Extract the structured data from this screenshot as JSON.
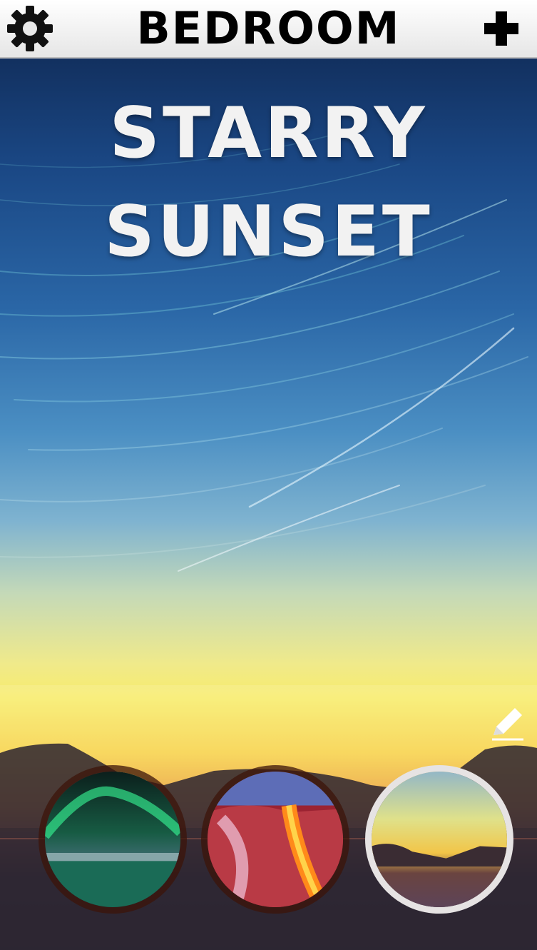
{
  "header": {
    "title": "BEDROOM",
    "settings_icon": "gear-icon",
    "add_icon": "plus-icon"
  },
  "scene": {
    "title_line1": "STARRY",
    "title_line2": "SUNSET"
  },
  "presets": [
    {
      "name": "aurora",
      "selected": false
    },
    {
      "name": "lava",
      "selected": false
    },
    {
      "name": "starry-sunset",
      "selected": true
    }
  ],
  "edit_icon": "pencil-icon",
  "colors": {
    "header_bg": "#f0f0f0",
    "title_color": "#f2f2f2",
    "selected_ring": "#e6e3e3"
  }
}
